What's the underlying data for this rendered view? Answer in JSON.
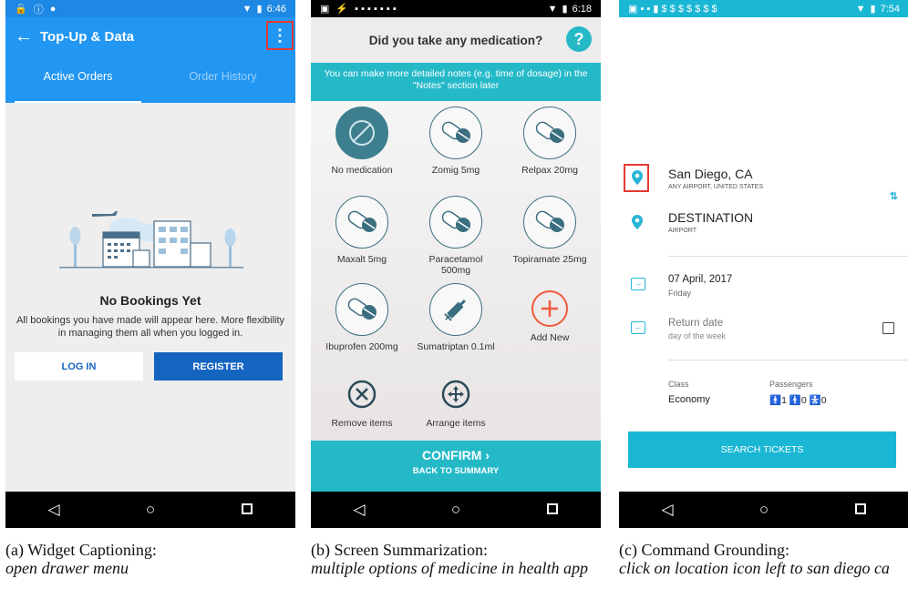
{
  "phone_a": {
    "status": {
      "time": "6:46"
    },
    "toolbar": {
      "back_icon": "back-arrow-icon",
      "title": "Top-Up & Data",
      "more_icon": "more-vertical-icon"
    },
    "tabs": [
      {
        "label": "Active Orders"
      },
      {
        "label": "Order History"
      }
    ],
    "empty_state": {
      "title": "No Bookings Yet",
      "text": "All bookings you have made will appear here. More flexibility in managing them all when you logged in."
    },
    "buttons": {
      "login": "LOG IN",
      "register": "REGISTER"
    },
    "colors": {
      "primary": "#2196f3",
      "button": "#1565c0",
      "highlight": "#e53935"
    }
  },
  "phone_b": {
    "status": {
      "time": "6:18"
    },
    "header": {
      "title": "Did you take any medication?",
      "help": "?"
    },
    "info_banner": "You can make more detailed notes (e.g. time of dosage) in the \"Notes\" section later",
    "medications": [
      {
        "label": "No medication",
        "icon": "no-medication-icon"
      },
      {
        "label": "Zomig 5mg",
        "icon": "pill-icon"
      },
      {
        "label": "Relpax 20mg",
        "icon": "pill-icon"
      },
      {
        "label": "Maxalt 5mg",
        "icon": "pill-icon"
      },
      {
        "label": "Paracetamol 500mg",
        "icon": "pill-icon"
      },
      {
        "label": "Topiramate 25mg",
        "icon": "pill-icon"
      },
      {
        "label": "Ibuprofen 200mg",
        "icon": "pill-icon"
      },
      {
        "label": "Sumatriptan 0.1ml",
        "icon": "syringe-icon"
      },
      {
        "label": "Add New",
        "icon": "add-icon"
      },
      {
        "label": "Remove items",
        "icon": "remove-icon"
      },
      {
        "label": "Arrange items",
        "icon": "arrange-icon"
      }
    ],
    "confirm": {
      "label": "CONFIRM",
      "sub": "BACK TO SUMMARY"
    },
    "colors": {
      "accent": "#25b9c8",
      "add": "#f05a3c",
      "selected": "#3e7f8f"
    }
  },
  "phone_c": {
    "status": {
      "time": "7:54"
    },
    "origin": {
      "city": "San Diego, CA",
      "sub": "ANY AIRPORT, UNITED STATES"
    },
    "destination": {
      "label": "DESTINATION",
      "sub": "AIRPORT"
    },
    "depart": {
      "date": "07 April, 2017",
      "day": "Friday"
    },
    "return": {
      "label": "Return date",
      "sub": "day of the week"
    },
    "class": {
      "label": "Class",
      "value": "Economy"
    },
    "passengers": {
      "label": "Passengers",
      "value": "🚹1 🚹0 🚼0"
    },
    "search_button": "SEARCH TICKETS",
    "colors": {
      "accent": "#1ab7d4",
      "highlight": "#e53935"
    }
  },
  "captions": {
    "a": {
      "title": "(a) Widget Captioning:",
      "text": "open drawer menu"
    },
    "b": {
      "title": "(b) Screen Summarization:",
      "text": "multiple options of medicine in health app"
    },
    "c": {
      "title": "(c) Command Grounding:",
      "text": "click on location icon left to san diego ca"
    }
  }
}
